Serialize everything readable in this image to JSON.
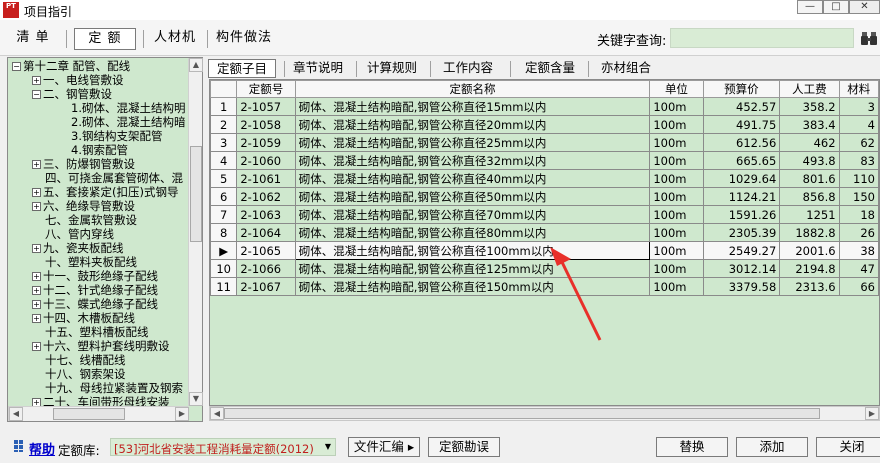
{
  "window": {
    "title": "项目指引",
    "icon_text": "PT"
  },
  "toolbar": {
    "tabs": [
      {
        "label": "清  单"
      },
      {
        "label": "定  额"
      },
      {
        "label": "人材机"
      },
      {
        "label": "构件做法"
      }
    ],
    "active_tab": "定  额",
    "keyword_label": "关键字查询:",
    "keyword_value": ""
  },
  "tree": {
    "items": [
      {
        "label": "第十二章 配管、配线",
        "level": 0,
        "expander": "−"
      },
      {
        "label": "一、电线管敷设",
        "level": 1,
        "expander": "+"
      },
      {
        "label": "二、钢管敷设",
        "level": 1,
        "expander": "−"
      },
      {
        "label": "1.砌体、混凝土结构明",
        "level": 2,
        "expander": ""
      },
      {
        "label": "2.砌体、混凝土结构暗",
        "level": 2,
        "expander": ""
      },
      {
        "label": "3.钢结构支架配管",
        "level": 2,
        "expander": ""
      },
      {
        "label": "4.钢索配管",
        "level": 2,
        "expander": ""
      },
      {
        "label": "三、防爆钢管敷设",
        "level": 1,
        "expander": "+"
      },
      {
        "label": "四、可挠金属套管砌体、混",
        "level": 1,
        "expander": ""
      },
      {
        "label": "五、套接紧定(扣压)式钢导",
        "level": 1,
        "expander": "+"
      },
      {
        "label": "六、绝缘导管敷设",
        "level": 1,
        "expander": "+"
      },
      {
        "label": "七、金属软管敷设",
        "level": 1,
        "expander": ""
      },
      {
        "label": "八、管内穿线",
        "level": 1,
        "expander": ""
      },
      {
        "label": "九、瓷夹板配线",
        "level": 1,
        "expander": "+"
      },
      {
        "label": "十、塑料夹板配线",
        "level": 1,
        "expander": ""
      },
      {
        "label": "十一、鼓形绝缘子配线",
        "level": 1,
        "expander": "+"
      },
      {
        "label": "十二、针式绝缘子配线",
        "level": 1,
        "expander": "+"
      },
      {
        "label": "十三、蝶式绝缘子配线",
        "level": 1,
        "expander": "+"
      },
      {
        "label": "十四、木槽板配线",
        "level": 1,
        "expander": "+"
      },
      {
        "label": "十五、塑料槽板配线",
        "level": 1,
        "expander": ""
      },
      {
        "label": "十六、塑料护套线明敷设",
        "level": 1,
        "expander": "+"
      },
      {
        "label": "十七、线槽配线",
        "level": 1,
        "expander": ""
      },
      {
        "label": "十八、钢索架设",
        "level": 1,
        "expander": ""
      },
      {
        "label": "十九、母线拉紧装置及钢索",
        "level": 1,
        "expander": ""
      },
      {
        "label": "二十、车间带形母线安装",
        "level": 1,
        "expander": "+"
      }
    ]
  },
  "tabs": {
    "items": [
      {
        "label": "定额子目"
      },
      {
        "label": "章节说明"
      },
      {
        "label": "计算规则"
      },
      {
        "label": "工作内容"
      },
      {
        "label": "定额含量"
      },
      {
        "label": "亦材组合"
      }
    ],
    "active": "定额子目"
  },
  "grid": {
    "columns": [
      "",
      "定额号",
      "定额名称",
      "单位",
      "预算价",
      "人工费",
      "材料"
    ],
    "rows": [
      {
        "n": "1",
        "code": "2-1057",
        "name": "砌体、混凝土结构暗配,钢管公称直径15mm以内",
        "unit": "100m",
        "price": "452.57",
        "labor": "358.2",
        "mat": "3"
      },
      {
        "n": "2",
        "code": "2-1058",
        "name": "砌体、混凝土结构暗配,钢管公称直径20mm以内",
        "unit": "100m",
        "price": "491.75",
        "labor": "383.4",
        "mat": "4"
      },
      {
        "n": "3",
        "code": "2-1059",
        "name": "砌体、混凝土结构暗配,钢管公称直径25mm以内",
        "unit": "100m",
        "price": "612.56",
        "labor": "462",
        "mat": "62"
      },
      {
        "n": "4",
        "code": "2-1060",
        "name": "砌体、混凝土结构暗配,钢管公称直径32mm以内",
        "unit": "100m",
        "price": "665.65",
        "labor": "493.8",
        "mat": "83"
      },
      {
        "n": "5",
        "code": "2-1061",
        "name": "砌体、混凝土结构暗配,钢管公称直径40mm以内",
        "unit": "100m",
        "price": "1029.64",
        "labor": "801.6",
        "mat": "110"
      },
      {
        "n": "6",
        "code": "2-1062",
        "name": "砌体、混凝土结构暗配,钢管公称直径50mm以内",
        "unit": "100m",
        "price": "1124.21",
        "labor": "856.8",
        "mat": "150"
      },
      {
        "n": "7",
        "code": "2-1063",
        "name": "砌体、混凝土结构暗配,钢管公称直径70mm以内",
        "unit": "100m",
        "price": "1591.26",
        "labor": "1251",
        "mat": "18"
      },
      {
        "n": "8",
        "code": "2-1064",
        "name": "砌体、混凝土结构暗配,钢管公称直径80mm以内",
        "unit": "100m",
        "price": "2305.39",
        "labor": "1882.8",
        "mat": "26"
      },
      {
        "n": "▶",
        "code": "2-1065",
        "name": "砌体、混凝土结构暗配,钢管公称直径100mm以内",
        "unit": "100m",
        "price": "2549.27",
        "labor": "2001.6",
        "mat": "38"
      },
      {
        "n": "10",
        "code": "2-1066",
        "name": "砌体、混凝土结构暗配,钢管公称直径125mm以内",
        "unit": "100m",
        "price": "3012.14",
        "labor": "2194.8",
        "mat": "47"
      },
      {
        "n": "11",
        "code": "2-1067",
        "name": "砌体、混凝土结构暗配,钢管公称直径150mm以内",
        "unit": "100m",
        "price": "3379.58",
        "labor": "2313.6",
        "mat": "66"
      }
    ],
    "selected_row": 9
  },
  "bottom": {
    "help_label": "帮助",
    "library_label": "定额库:",
    "library_value": "[53]河北省安装工程消耗量定额(2012)",
    "file_button": "文件汇编 ▸",
    "errata_button": "定额勘误",
    "replace_button": "替换",
    "add_button": "添加",
    "close_button": "关闭"
  },
  "colors": {
    "grid_background": "#cfe8ce",
    "annotation_arrow": "#e8302a",
    "library_text": "#c0201e",
    "help_link": "#0000cc"
  }
}
